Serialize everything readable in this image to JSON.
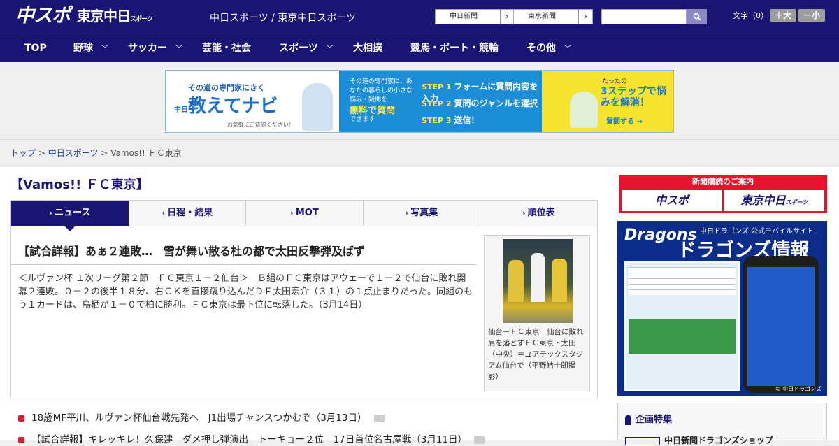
{
  "header": {
    "logo_chuspo": "中スポ",
    "logo_tokyo": "東京中日",
    "logo_tokyo_small": "スポーツ",
    "site_title": "中日スポーツ / 東京中日スポーツ",
    "link_chunichi": "中日新聞",
    "link_tokyo": "東京新聞",
    "link_arrow": "›",
    "search_placeholder": "",
    "search_icon": "magnifier-icon",
    "font_size_label": "文字（0）",
    "font_up": "＋大",
    "font_down": "－小"
  },
  "nav": {
    "items": [
      {
        "label": "TOP",
        "has_menu": false
      },
      {
        "label": "野球",
        "has_menu": true
      },
      {
        "label": "サッカー",
        "has_menu": true
      },
      {
        "label": "芸能・社会",
        "has_menu": false
      },
      {
        "label": "スポーツ",
        "has_menu": true
      },
      {
        "label": "大相撲",
        "has_menu": false
      },
      {
        "label": "競馬・ボート・競輪",
        "has_menu": false
      },
      {
        "label": "その他",
        "has_menu": true
      }
    ],
    "chevron": "﹀"
  },
  "banner": {
    "tagline": "その道の専門家にきく",
    "brand_small": "中日",
    "brand": "教えてナビ",
    "cta_small": "お気軽にご質問ください！",
    "mid_text": "その道の専門家に、あなたの暮らしの小さな悩み・疑問を",
    "mid_highlight": "無料で質問",
    "mid_tail": "できます",
    "steps": [
      {
        "num": "STEP 1",
        "text": "フォームに質問内容を入力"
      },
      {
        "num": "STEP 2",
        "text": "質問のジャンルを選択"
      },
      {
        "num": "STEP 3",
        "text": "送信！"
      }
    ],
    "right_small": "たったの",
    "right_main": "3ステップで悩みを解消！",
    "right_cta": "質問する →"
  },
  "breadcrumb": {
    "home": "トップ",
    "sep": ">",
    "parent": "中日スポーツ",
    "current": "Vamos!! ＦＣ東京"
  },
  "page": {
    "title": "【Vamos!! ＦＣ東京】",
    "tabs": [
      {
        "label": "ニュース",
        "active": true
      },
      {
        "label": "日程・結果",
        "active": false
      },
      {
        "label": "MOT",
        "active": false
      },
      {
        "label": "写真集",
        "active": false
      },
      {
        "label": "順位表",
        "active": false
      }
    ],
    "tab_arrow": "›"
  },
  "article": {
    "title": "【試合詳報】あぁ２連敗…　雪が舞い散る杜の都で太田反撃弾及ばず",
    "body": "＜ルヴァン杯 １次リーグ第２節　ＦＣ東京１－２仙台＞　Ｂ組のＦＣ東京はアウェーで１－２で仙台に敗れ開幕２連敗。０－２の後半１８分、右ＣＫを直接蹴り込んだＤＦ太田宏介（３１）の１点止まりだった。同組のもう１カードは、鳥栖が１－０で柏に勝利。ＦＣ東京は最下位に転落した。（3月14日）",
    "photo_caption": "仙台－ＦＣ東京　仙台に敗れ肩を落とすＦＣ東京・太田（中央）＝ユアテックスタジアム仙台で（平野皓士朗撮影）"
  },
  "news_list": [
    {
      "text": "18歳MF平川、ルヴァン杯仙台戦先発へ　J1出場チャンスつかむぞ（3月13日）",
      "has_photo": true
    },
    {
      "text": "【試合詳報】キレッキレ！久保建　ダメ押し弾演出　トーキョー２位　17日首位名古屋戦（3月11日）",
      "has_photo": true
    }
  ],
  "sidebar": {
    "subscribe_header": "新聞購読のご案内",
    "subscribe_chuspo": "中スポ",
    "subscribe_tokyo": "東京中日",
    "subscribe_tokyo_small": "スポーツ",
    "dragons_logo": "Dragons",
    "dragons_sub": "中日ドラゴンズ 公式モバイルサイト",
    "dragons_title": "ドラゴンズ情報",
    "dragons_copy": "© 中日ドラゴンズ",
    "kikaku_header": "企画特集",
    "kikaku_item": "中日新聞ドラゴンズショップ"
  },
  "colors": {
    "header_bg": "#1a1572",
    "accent_red": "#cc2233",
    "banner_blue": "#1c8ed8",
    "banner_yellow": "#f6e32d"
  }
}
